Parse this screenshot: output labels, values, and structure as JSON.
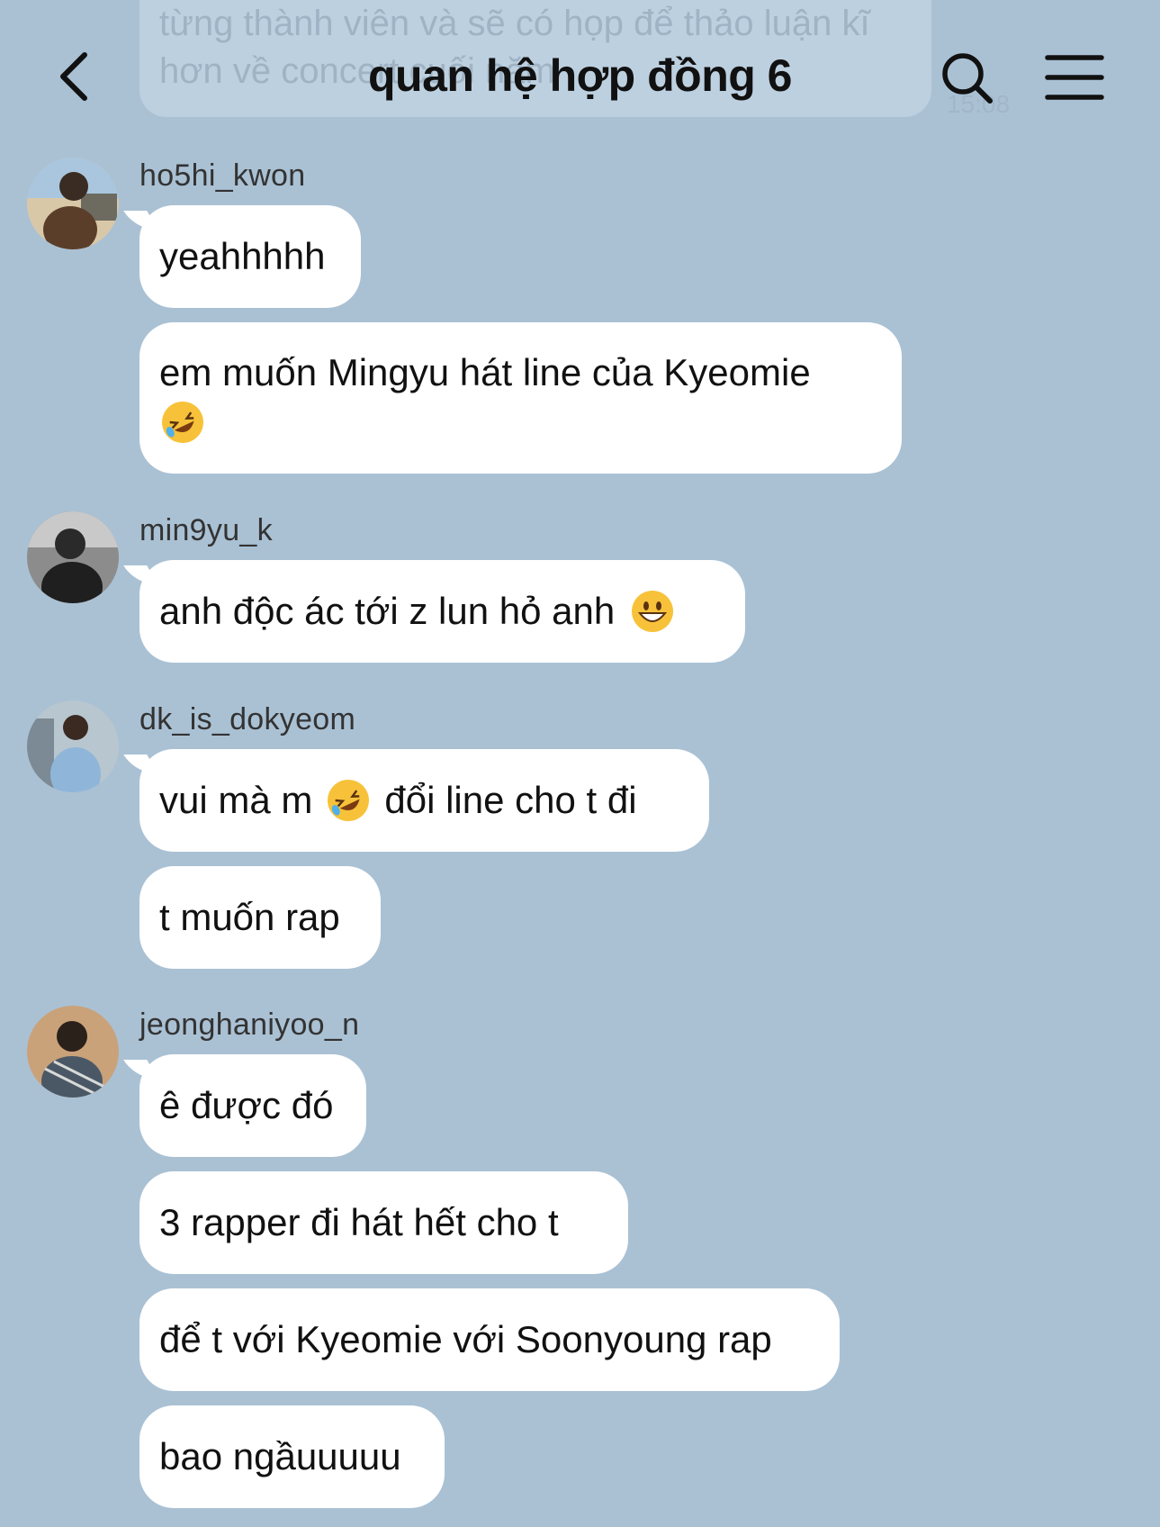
{
  "header": {
    "title": "quan hệ hợp đồng 6",
    "back_icon": "chevron-left-icon",
    "search_icon": "search-icon",
    "menu_icon": "hamburger-menu-icon"
  },
  "previous_message": {
    "text": "từng thành viên và sẽ có họp để thảo luận kĩ hơn về concert cuối năm",
    "time": "15:08"
  },
  "groups": [
    {
      "username": "ho5hi_kwon",
      "messages": [
        {
          "text": "yeahhhhh"
        },
        {
          "text": "em muốn Mingyu hát line của Kyeomie",
          "emoji": "rolling-on-floor-laughing"
        }
      ]
    },
    {
      "username": "min9yu_k",
      "messages": [
        {
          "text": "anh độc ác tới z lun hỏ anh",
          "emoji": "grinning-face"
        }
      ]
    },
    {
      "username": "dk_is_dokyeom",
      "messages": [
        {
          "text_before": "vui mà m",
          "emoji": "rolling-on-floor-laughing",
          "text_after": "đổi line cho t đi"
        },
        {
          "text": "t muốn rap"
        }
      ]
    },
    {
      "username": "jeonghaniyoo_n",
      "messages": [
        {
          "text": "ê được đó"
        },
        {
          "text": "3 rapper đi hát hết cho t"
        },
        {
          "text": "để t với Kyeomie với Soonyoung rap"
        },
        {
          "text": "bao ngầuuuuu"
        }
      ]
    }
  ],
  "colors": {
    "background": "#aac1d4",
    "bubble": "#ffffff",
    "text": "#111111",
    "username": "#333333"
  }
}
